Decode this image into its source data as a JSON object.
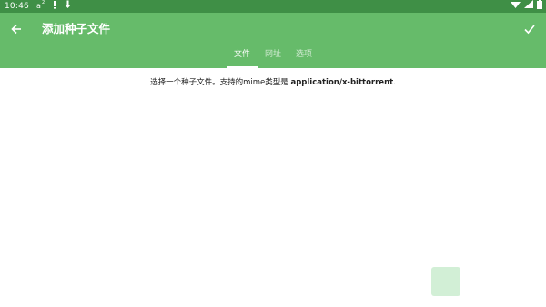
{
  "status_bar": {
    "time": "10:46",
    "icons": [
      "a-superscript-icon",
      "alert-icon",
      "download-icon"
    ],
    "right_icons": [
      "wifi-icon",
      "signal-icon",
      "battery-icon"
    ]
  },
  "app_bar": {
    "title": "添加种子文件",
    "back_icon": "back-arrow-icon",
    "confirm_icon": "check-icon"
  },
  "tabs": [
    {
      "label": "文件",
      "active": true
    },
    {
      "label": "网址",
      "active": false
    },
    {
      "label": "选项",
      "active": false
    }
  ],
  "content": {
    "info_prefix": "选择一个种子文件。支持的mime类型是 ",
    "info_mime": "application/x-bittorrent",
    "info_suffix": "."
  },
  "colors": {
    "status_bar": "#3f8f46",
    "app_bar": "#66bb6a",
    "text": "#222222"
  }
}
